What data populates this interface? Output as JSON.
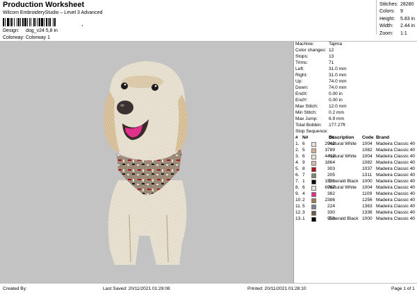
{
  "header": {
    "title": "Production Worksheet",
    "software": "Wilcom EmbroideryStudio – Level 3 Advanced",
    "design_label": "Design:",
    "design_value": "dog_v24 5,8 in",
    "colorway_label": "Colorway:",
    "colorway_value": "Colorway 1"
  },
  "top_stats": [
    {
      "label": "Stitches:",
      "value": "28280"
    },
    {
      "label": "Colors:",
      "value": "9"
    },
    {
      "label": "Height:",
      "value": "5.83 in"
    },
    {
      "label": "Width:",
      "value": "2.44 in"
    },
    {
      "label": "Zoom:",
      "value": "1:1"
    }
  ],
  "properties": [
    {
      "label": "Machine:",
      "value": "Tajima"
    },
    {
      "label": "Color changes:",
      "value": "12"
    },
    {
      "label": "Stops:",
      "value": "13"
    },
    {
      "label": "Trims:",
      "value": "71"
    },
    {
      "label": "Left:",
      "value": "31.0 mm"
    },
    {
      "label": "Right:",
      "value": "31.0 mm"
    },
    {
      "label": "Up:",
      "value": "74.0 mm"
    },
    {
      "label": "Down:",
      "value": "74.0 mm"
    },
    {
      "label": "EndX:",
      "value": "0.00 in"
    },
    {
      "label": "EndY:",
      "value": "0.00 in"
    },
    {
      "label": "Max Stitch:",
      "value": "12.0 mm"
    },
    {
      "label": "Min Stitch:",
      "value": "0.2 mm"
    },
    {
      "label": "Max Jump:",
      "value": "6.9 mm"
    },
    {
      "label": "Total Bobbin:",
      "value": "177.27ft"
    }
  ],
  "stop_sequence": {
    "label": "Stop Sequence:",
    "headers": {
      "n": "N#",
      "st": "St.",
      "desc": "Description",
      "code": "Code",
      "brand": "Brand"
    },
    "rows": [
      {
        "arrow": "1.",
        "n": "6",
        "color": "#e8e2d4",
        "st": "2942",
        "desc": "Natural White",
        "code": "1004",
        "brand": "Madeira Classic 40"
      },
      {
        "arrow": "2.",
        "n": "5",
        "color": "#d2b48c",
        "st": "3789",
        "desc": "",
        "code": "1082",
        "brand": "Madeira Classic 40"
      },
      {
        "arrow": "3.",
        "n": "6",
        "color": "#e8e2d4",
        "st": "4412",
        "desc": "Natural White",
        "code": "1004",
        "brand": "Madeira Classic 40"
      },
      {
        "arrow": "4.",
        "n": "9",
        "color": "#d8c0a8",
        "st": "1864",
        "desc": "",
        "code": "1082",
        "brand": "Madeira Classic 40"
      },
      {
        "arrow": "5.",
        "n": "8",
        "color": "#b0141e",
        "st": "303",
        "desc": "",
        "code": "1037",
        "brand": "Madeira Classic 40"
      },
      {
        "arrow": "6.",
        "n": "7",
        "color": "#7a8a6a",
        "st": "205",
        "desc": "",
        "code": "1311",
        "brand": "Madeira Classic 40"
      },
      {
        "arrow": "7.",
        "n": "1",
        "color": "#000000",
        "st": "1521",
        "desc": "Emerald Black",
        "code": "1000",
        "brand": "Madeira Classic 40"
      },
      {
        "arrow": "8.",
        "n": "6",
        "color": "#e8e2d4",
        "st": "6967",
        "desc": "Natural White",
        "code": "1004",
        "brand": "Madeira Classic 40"
      },
      {
        "arrow": "9.",
        "n": "4",
        "color": "#e0308c",
        "st": "382",
        "desc": "",
        "code": "1109",
        "brand": "Madeira Classic 40"
      },
      {
        "arrow": "10.",
        "n": "2",
        "color": "#a07850",
        "st": "2386",
        "desc": "",
        "code": "1256",
        "brand": "Madeira Classic 40"
      },
      {
        "arrow": "11.",
        "n": "5",
        "color": "#7c8290",
        "st": "224",
        "desc": "",
        "code": "1363",
        "brand": "Madeira Classic 40"
      },
      {
        "arrow": "12.",
        "n": "3",
        "color": "#6b5a48",
        "st": "330",
        "desc": "",
        "code": "1336",
        "brand": "Madeira Classic 40"
      },
      {
        "arrow": "13.",
        "n": "1",
        "color": "#000000",
        "st": "953",
        "desc": "Emerald Black",
        "code": "1000",
        "brand": "Madeira Classic 40"
      }
    ]
  },
  "footer": {
    "created_by": "Created By:",
    "last_saved": "Last Saved: 20/11/2021 01:28:08",
    "printed": "Printed: 20/11/2021 01:28:10",
    "page": "Page 1 of 1"
  }
}
